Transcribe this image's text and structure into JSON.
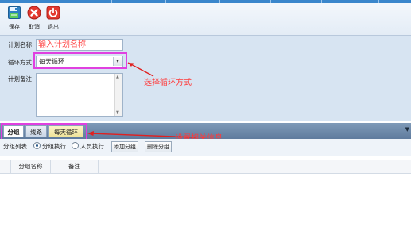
{
  "toolbar": {
    "save": "保存",
    "cancel": "取消",
    "exit": "退出"
  },
  "form": {
    "name_label": "计划名称",
    "name_placeholder": "输入计划名称",
    "cycle_label": "循环方式",
    "cycle_value": "每天循环",
    "remark_label": "计划备注",
    "remark_value": ""
  },
  "annotations": {
    "cycle_note": "选择循环方式",
    "tabs_note": "设置相关信息"
  },
  "tabs": [
    {
      "label": "分组",
      "active": true
    },
    {
      "label": "线路",
      "active": false
    },
    {
      "label": "每天循环",
      "active": false
    }
  ],
  "options": {
    "list_label": "分组列表",
    "radio1": "分组执行",
    "radio2": "人员执行",
    "selected": "分组执行",
    "add_group": "添加分组",
    "delete_group": "删除分组"
  },
  "grid": {
    "columns": [
      "分组名称",
      "备注"
    ]
  },
  "colors": {
    "annotation_red": "#ff3a3a",
    "highlight_pink": "#e040e0",
    "form_bg": "#d7e4f2",
    "tab_bar": "#6d88a9"
  }
}
